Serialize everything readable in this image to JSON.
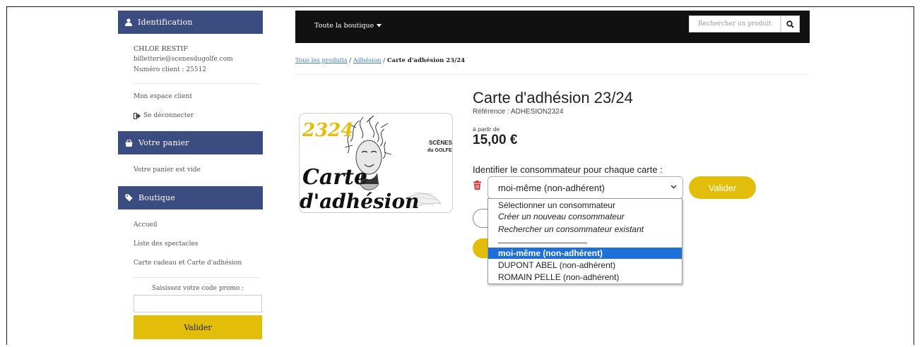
{
  "sidebar": {
    "identification": {
      "title": "Identification",
      "name": "CHLOE RESTIF",
      "email": "billetterie@scenesdugolfe.com",
      "client_number": "Numéro client : 25512",
      "account_link": "Mon espace client",
      "logout": "Se déconnecter"
    },
    "cart": {
      "title": "Votre panier",
      "empty_text": "Votre panier est vide"
    },
    "shop": {
      "title": "Boutique",
      "items": [
        "Accueil",
        "Liste des spectacles",
        "Carte cadeau et Carte d'adhésion"
      ]
    },
    "promo": {
      "label": "Saisissez votre code promo :",
      "value": "",
      "button": "Valider"
    }
  },
  "topbar": {
    "menu": "Toute la boutique",
    "search_placeholder": "Rechercher un produit"
  },
  "breadcrumb": {
    "items": [
      "Tous les produits",
      "Adhésion"
    ],
    "current": "Carte d'adhésion 23/24"
  },
  "product": {
    "title": "Carte d'adhésion 23/24",
    "reference": "Référence : ADHESION2324",
    "from_label": "à partir de",
    "price": "15,00 €",
    "identify_label": "Identifier le consommateur pour chaque carte :",
    "selected_consumer": "moi-même (non-adhérent)",
    "validate_button": "Valider",
    "image": {
      "year_text": "2324",
      "brand_text": [
        "SCÈNES",
        "du GOLFE"
      ],
      "card_text": [
        "Carte",
        "d'adhésion"
      ]
    }
  },
  "dropdown": {
    "options": [
      "Sélectionner un consommateur",
      "Créer un nouveau consommateur",
      "Rechercher un consommateur existant",
      "moi-même (non-adhérent)",
      "DUPONT ABEL (non-adhérent)",
      "ROMAIN PELLE (non-adhérent)"
    ],
    "selected_index": 3
  },
  "colors": {
    "sidebar_header": "#3b4c80",
    "accent_yellow": "#e2be0b",
    "topbar": "#111111",
    "link": "#3a7fc4",
    "selection": "#1e6fd9",
    "trash": "#d32f2f"
  },
  "icons": [
    "user-icon",
    "cart-icon",
    "tag-icon",
    "logout-icon",
    "search-icon",
    "caret-down-icon",
    "trash-icon",
    "chevron-down-icon"
  ]
}
